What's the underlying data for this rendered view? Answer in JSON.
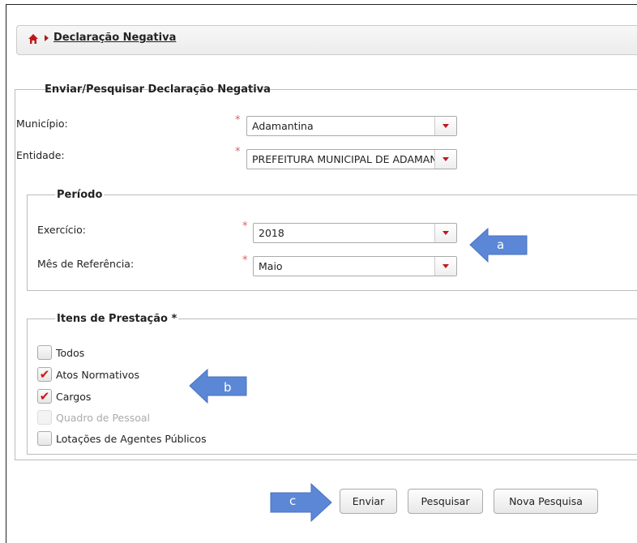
{
  "breadcrumb": {
    "home_icon": "home-icon",
    "current": "Declaração Negativa"
  },
  "form": {
    "legend": "Enviar/Pesquisar Declaração Negativa",
    "municipio": {
      "label": "Município:",
      "value": "Adamantina"
    },
    "entidade": {
      "label": "Entidade:",
      "value": "PREFEITURA MUNICIPAL DE ADAMANTINA"
    },
    "required_marker": "*"
  },
  "periodo": {
    "legend": "Período",
    "exercicio": {
      "label": "Exercício:",
      "value": "2018"
    },
    "mes": {
      "label": "Mês de Referência:",
      "value": "Maio"
    }
  },
  "itens": {
    "legend": "Itens de Prestação *",
    "items": [
      {
        "label": "Todos",
        "checked": false,
        "disabled": false
      },
      {
        "label": "Atos Normativos",
        "checked": true,
        "disabled": false
      },
      {
        "label": "Cargos",
        "checked": true,
        "disabled": false
      },
      {
        "label": "Quadro de Pessoal",
        "checked": false,
        "disabled": true
      },
      {
        "label": "Lotações de Agentes Públicos",
        "checked": false,
        "disabled": false
      }
    ]
  },
  "buttons": {
    "enviar": "Enviar",
    "pesquisar": "Pesquisar",
    "nova": "Nova Pesquisa"
  },
  "callouts": {
    "a": "a",
    "b": "b",
    "c": "c"
  },
  "colors": {
    "accent_red": "#c01818",
    "callout_blue": "#5b87d6"
  }
}
